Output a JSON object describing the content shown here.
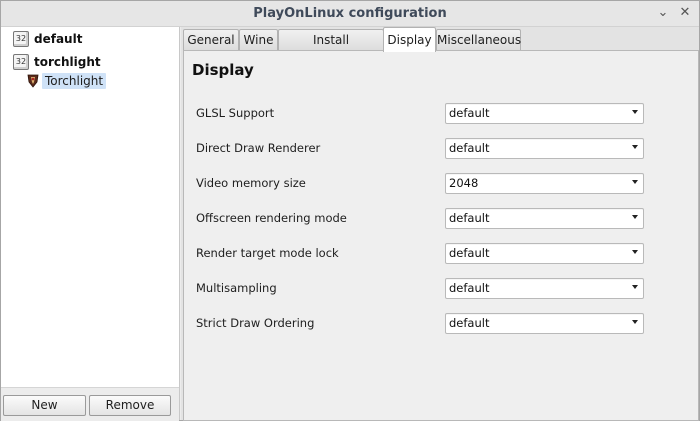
{
  "window": {
    "title": "PlayOnLinux configuration",
    "minimize_glyph": "⌄",
    "close_glyph": "✕"
  },
  "sidebar": {
    "items": [
      {
        "label": "default",
        "icon": "32",
        "icon_name": "32-bit-icon"
      },
      {
        "label": "torchlight",
        "icon": "32",
        "icon_name": "32-bit-icon"
      },
      {
        "label": "Torchlight",
        "icon_name": "torchlight-app-icon",
        "selected": true
      }
    ],
    "new_label": "New",
    "remove_label": "Remove"
  },
  "tabs": [
    {
      "label": "General"
    },
    {
      "label": "Wine"
    },
    {
      "label": "Install components"
    },
    {
      "label": "Display",
      "active": true
    },
    {
      "label": "Miscellaneous"
    }
  ],
  "display": {
    "heading": "Display",
    "settings": [
      {
        "label": "GLSL Support",
        "value": "default"
      },
      {
        "label": "Direct Draw Renderer",
        "value": "default"
      },
      {
        "label": "Video memory size",
        "value": "2048"
      },
      {
        "label": "Offscreen rendering mode",
        "value": "default"
      },
      {
        "label": "Render target mode lock",
        "value": "default"
      },
      {
        "label": "Multisampling",
        "value": "default"
      },
      {
        "label": "Strict Draw Ordering",
        "value": "default"
      }
    ]
  },
  "colors": {
    "selection": "#cfe2f7",
    "title_text": "#3f4a5a"
  }
}
